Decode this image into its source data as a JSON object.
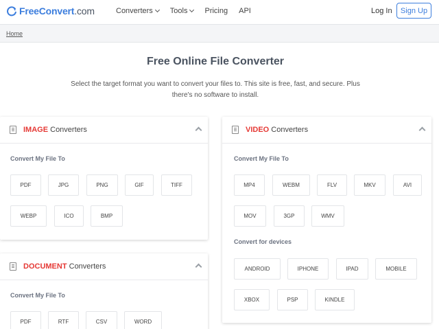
{
  "header": {
    "logo_brand": "FreeConvert",
    "logo_suffix": ".com",
    "nav": [
      "Converters",
      "Tools",
      "Pricing",
      "API"
    ],
    "login": "Log In",
    "signup": "Sign Up"
  },
  "breadcrumb": "Home",
  "page": {
    "title": "Free Online File Converter",
    "subtitle": "Select the target format you want to convert your files to. This site is free, fast, and secure. Plus there's no software to install."
  },
  "image_card": {
    "accent": "IMAGE",
    "title_rest": " Converters",
    "section": "Convert My File To",
    "formats": [
      "PDF",
      "JPG",
      "PNG",
      "GIF",
      "TIFF",
      "WEBP",
      "ICO",
      "BMP"
    ]
  },
  "document_card": {
    "accent": "DOCUMENT",
    "title_rest": " Converters",
    "section": "Convert My File To",
    "formats": [
      "PDF",
      "RTF",
      "CSV",
      "WORD"
    ]
  },
  "video_card": {
    "accent": "VIDEO",
    "title_rest": " Converters",
    "section": "Convert My File To",
    "formats": [
      "MP4",
      "WEBM",
      "FLV",
      "MKV",
      "AVI",
      "MOV",
      "3GP",
      "WMV"
    ],
    "devices_section": "Convert for devices",
    "devices": [
      "ANDROID",
      "IPHONE",
      "IPAD",
      "MOBILE",
      "XBOX",
      "PSP",
      "KINDLE"
    ]
  },
  "colors": {
    "accent": "#e53935",
    "brand": "#3b7ddd"
  }
}
